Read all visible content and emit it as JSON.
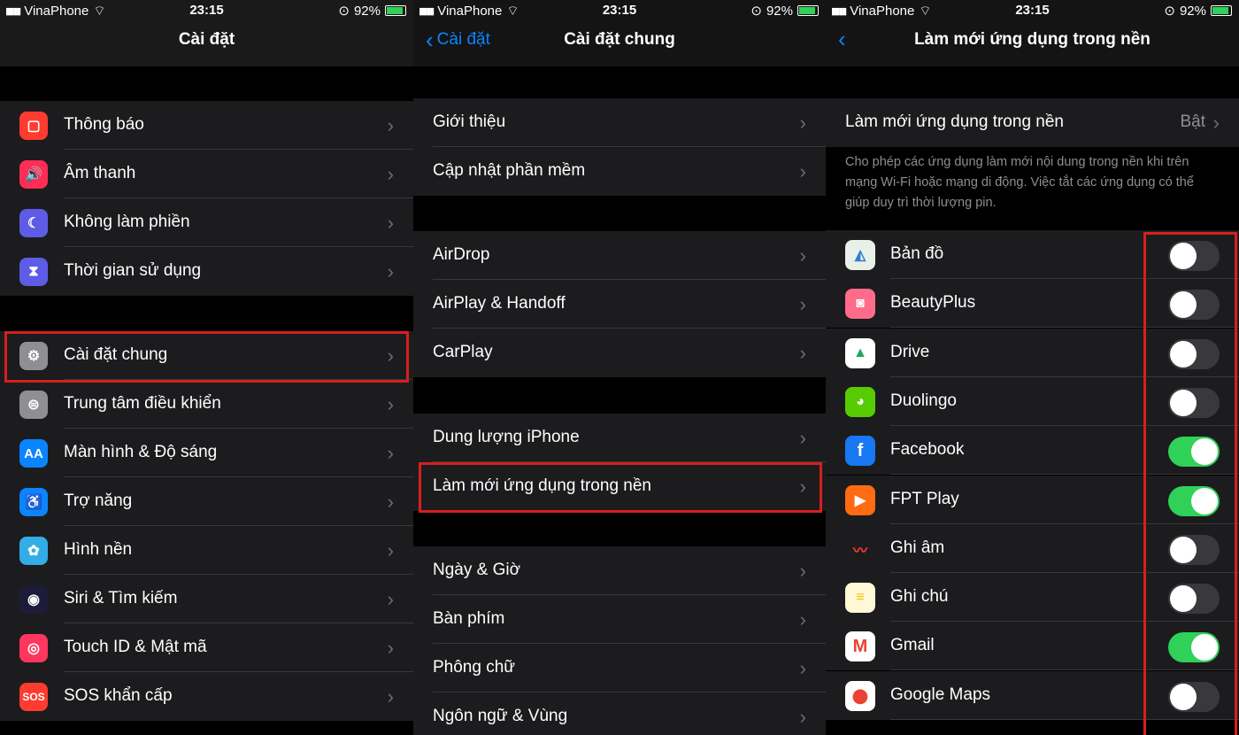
{
  "status": {
    "carrier": "VinaPhone",
    "time": "23:15",
    "battery": "92%"
  },
  "panel1": {
    "title": "Cài đặt",
    "items": [
      {
        "label": "Thông báo",
        "icon": "notifications-icon",
        "color": "#ff3b30"
      },
      {
        "label": "Âm thanh",
        "icon": "sound-icon",
        "color": "#ff2d55"
      },
      {
        "label": "Không làm phiền",
        "icon": "moon-icon",
        "color": "#5e5ce6"
      },
      {
        "label": "Thời gian sử dụng",
        "icon": "hourglass-icon",
        "color": "#5e5ce6"
      },
      {
        "label": "Cài đặt chung",
        "icon": "gear-icon",
        "color": "#8e8e93"
      },
      {
        "label": "Trung tâm điều khiển",
        "icon": "toggles-icon",
        "color": "#8e8e93"
      },
      {
        "label": "Màn hình & Độ sáng",
        "icon": "AA",
        "color": "#0a84ff"
      },
      {
        "label": "Trợ năng",
        "icon": "accessibility-icon",
        "color": "#0a84ff"
      },
      {
        "label": "Hình nền",
        "icon": "flower-icon",
        "color": "#32ade6"
      },
      {
        "label": "Siri & Tìm kiếm",
        "icon": "siri-icon",
        "color": "#1c1c3a"
      },
      {
        "label": "Touch ID & Mật mã",
        "icon": "fingerprint-icon",
        "color": "#ff375f"
      },
      {
        "label": "SOS khẩn cấp",
        "icon": "SOS",
        "color": "#ff3b30"
      }
    ]
  },
  "panel2": {
    "back": "Cài đặt",
    "title": "Cài đặt chung",
    "items": [
      {
        "label": "Giới thiệu"
      },
      {
        "label": "Cập nhật phần mềm"
      },
      {
        "label": "AirDrop"
      },
      {
        "label": "AirPlay & Handoff"
      },
      {
        "label": "CarPlay"
      },
      {
        "label": "Dung lượng iPhone"
      },
      {
        "label": "Làm mới ứng dụng trong nền"
      },
      {
        "label": "Ngày & Giờ"
      },
      {
        "label": "Bàn phím"
      },
      {
        "label": "Phông chữ"
      },
      {
        "label": "Ngôn ngữ & Vùng"
      }
    ]
  },
  "panel3": {
    "title": "Làm mới ứng dụng trong nền",
    "master": {
      "label": "Làm mới ứng dụng trong nền",
      "value": "Bật"
    },
    "footer": "Cho phép các ứng dụng làm mới nội dung trong nền khi trên mạng Wi-Fi hoặc mạng di động. Việc tắt các ứng dụng có thể giúp duy trì thời lượng pin.",
    "apps": [
      {
        "name": "Bản đồ",
        "icon": "maps-icon",
        "on": false
      },
      {
        "name": "BeautyPlus",
        "icon": "beautyplus-icon",
        "on": false
      },
      {
        "name": "Drive",
        "icon": "drive-icon",
        "on": false
      },
      {
        "name": "Duolingo",
        "icon": "duolingo-icon",
        "on": false
      },
      {
        "name": "Facebook",
        "icon": "f",
        "on": true
      },
      {
        "name": "FPT Play",
        "icon": "fptplay-icon",
        "on": true
      },
      {
        "name": "Ghi âm",
        "icon": "voice-memos-icon",
        "on": false
      },
      {
        "name": "Ghi chú",
        "icon": "notes-icon",
        "on": false
      },
      {
        "name": "Gmail",
        "icon": "M",
        "on": true
      },
      {
        "name": "Google Maps",
        "icon": "google-maps-icon",
        "on": false
      }
    ]
  },
  "colors": {
    "accent": "#0a84ff",
    "toggle_on": "#30d158",
    "highlight": "#d61f1f"
  }
}
